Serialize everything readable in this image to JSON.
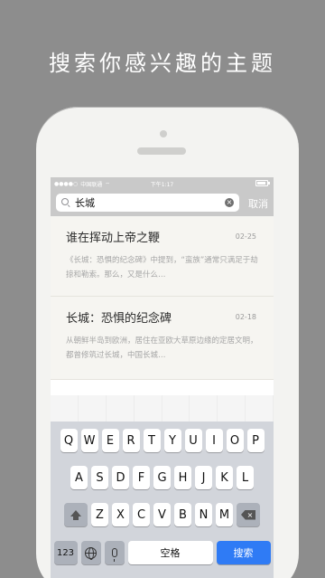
{
  "headline": "搜索你感兴趣的主题",
  "status_bar": {
    "signal": "●●●●○",
    "carrier": "中国联通",
    "wifi_icon": "wifi-icon",
    "time": "下午1:17",
    "battery_level": 0.85
  },
  "search": {
    "value": "长城",
    "cancel_label": "取消"
  },
  "results": [
    {
      "title": "谁在挥动上帝之鞭",
      "date": "02-25",
      "snippet": "《长城：恐惧的纪念碑》中提到，“蛮族”通常只满足于劫掠和勒索。那么，又是什么…"
    },
    {
      "title": "长城：恐惧的纪念碑",
      "date": "02-18",
      "snippet": "从朝鲜半岛到欧洲，居住在亚欧大草原边缘的定居文明，都曾修筑过长城，中国长城…"
    }
  ],
  "keyboard": {
    "row1": [
      "Q",
      "W",
      "E",
      "R",
      "T",
      "Y",
      "U",
      "I",
      "O",
      "P"
    ],
    "row2": [
      "A",
      "S",
      "D",
      "F",
      "G",
      "H",
      "J",
      "K",
      "L"
    ],
    "row3": [
      "Z",
      "X",
      "C",
      "V",
      "B",
      "N",
      "M"
    ],
    "numbers_label": "123",
    "space_label": "空格",
    "search_label": "搜索"
  },
  "colors": {
    "background": "#8d8d8d",
    "accent": "#2f7bf5",
    "search_bar": "#c9c9c9"
  }
}
